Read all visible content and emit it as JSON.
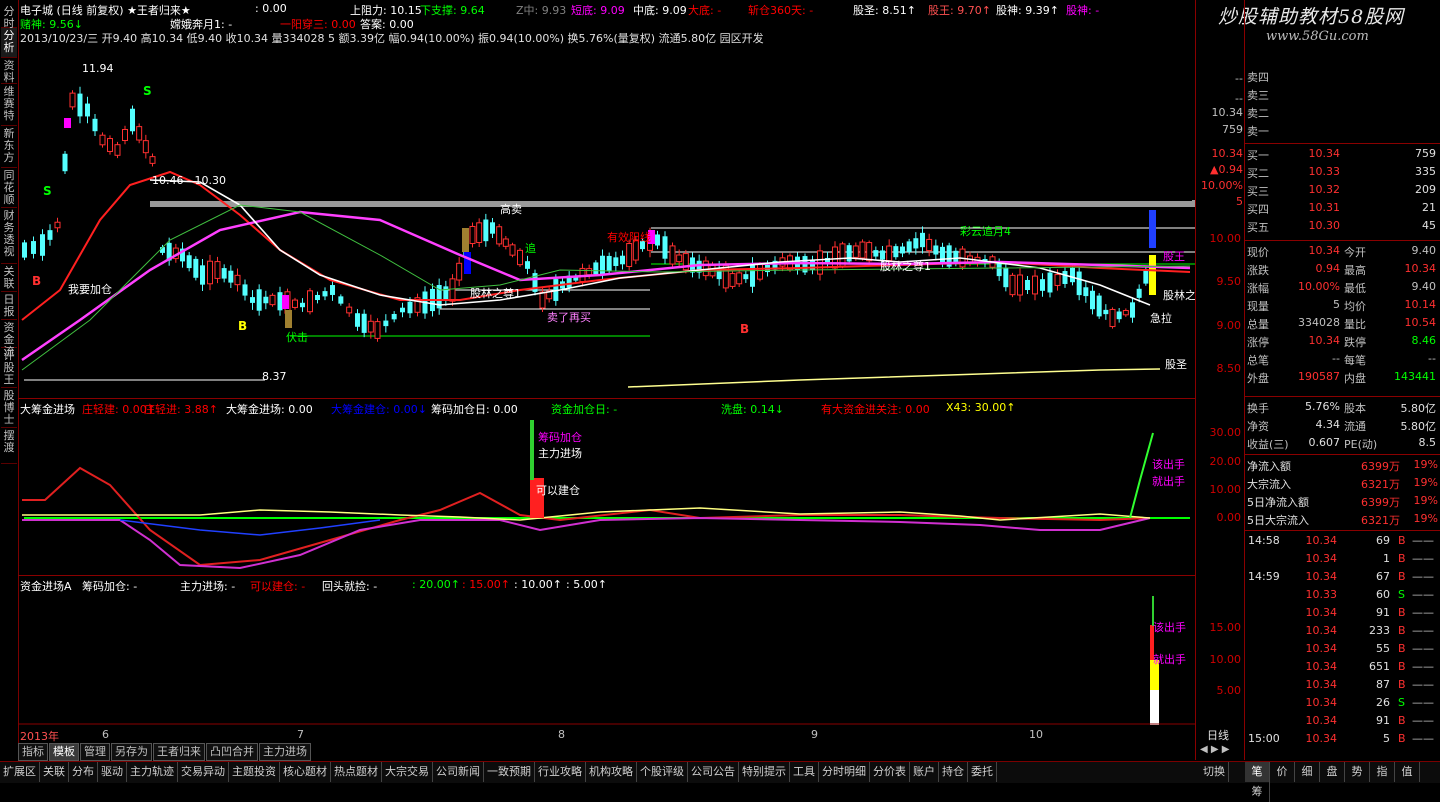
{
  "left_sidebar": [
    "分时",
    "分析",
    "资料",
    "维赛特",
    "新东方",
    "同花顺",
    "财务透视",
    "关联",
    "日报",
    "资金流",
    "评股王",
    "股博士",
    "摆渡"
  ],
  "header": {
    "row1": [
      {
        "t": "电子城 (日线 前复权) ★王者归来★",
        "c": "#ffffff"
      },
      {
        "t": ": 0.00",
        "c": "#ffffff"
      },
      {
        "t": "上阻力: 10.15",
        "c": "#ffffff"
      },
      {
        "t": "下支撑: 9.64",
        "c": "#00ff00"
      },
      {
        "t": "Z中: 9.93",
        "c": "#808080"
      },
      {
        "t": "短底: 9.09",
        "c": "#ff00ff"
      },
      {
        "t": "中底: 9.09",
        "c": "#ffffff"
      },
      {
        "t": "大底: -",
        "c": "#ff0000"
      },
      {
        "t": "斩仓360天: -",
        "c": "#ff0000"
      },
      {
        "t": "股圣: 8.51↑",
        "c": "#ffffff"
      },
      {
        "t": "股王: 9.70↑",
        "c": "#ff5050"
      },
      {
        "t": "股神: 9.39↑",
        "c": "#ffffff"
      },
      {
        "t": "股神: -",
        "c": "#ff00ff"
      }
    ],
    "row2": [
      {
        "t": "赌神: 9.56↓",
        "c": "#00ff00"
      },
      {
        "t": "嫦娥奔月1: -",
        "c": "#ffffff"
      },
      {
        "t": "一阳穿三: 0.00",
        "c": "#ff0000"
      },
      {
        "t": "答案: 0.00",
        "c": "#ffffff"
      }
    ],
    "row3": "2013/10/23/三 开9.40 高10.34 低9.40 收10.34 量334028 5 额3.39亿 幅0.94(10.00%) 振0.94(10.00%) 换5.76%(量复权) 流通5.80亿 园区开发",
    "watermark": "炒股辅助教材58股网",
    "watermark_url": "www.58Gu.com"
  },
  "main_chart": {
    "price_axis": [
      "10.00",
      "9.50",
      "9.00",
      "8.50"
    ],
    "annotations": [
      {
        "t": "11.94",
        "c": "#ffffff"
      },
      {
        "t": "10.46 - 10.30",
        "c": "#ffffff"
      },
      {
        "t": "高卖",
        "c": "#ffffff"
      },
      {
        "t": "追",
        "c": "#00ff00"
      },
      {
        "t": "我要加仓",
        "c": "#ffffff"
      },
      {
        "t": "伏击",
        "c": "#00ff00"
      },
      {
        "t": "8.37",
        "c": "#ffffff"
      },
      {
        "t": "股林之尊1",
        "c": "#ffffff"
      },
      {
        "t": "卖了再买",
        "c": "#ff80ff"
      },
      {
        "t": "有效阳线",
        "c": "#ff0000"
      },
      {
        "t": "股林之尊1",
        "c": "#ffffff"
      },
      {
        "t": "彩云追月4",
        "c": "#00ff00"
      },
      {
        "t": "股王",
        "c": "#ff00ff"
      },
      {
        "t": "股林之",
        "c": "#ffffff"
      },
      {
        "t": "急拉",
        "c": "#ffffff"
      },
      {
        "t": "股圣",
        "c": "#ffffff"
      }
    ],
    "signals": [
      "S",
      "S",
      "S",
      "B",
      "B",
      "B"
    ]
  },
  "indicator1": {
    "header": [
      {
        "t": "大筹金进场",
        "c": "#ffffff"
      },
      {
        "t": "庄轻建: 0.00↑",
        "c": "#ff0000"
      },
      {
        "t": "庄轻进: 3.88↑",
        "c": "#ff0000"
      },
      {
        "t": "大筹金进场: 0.00",
        "c": "#ffffff"
      },
      {
        "t": "大筹金建仓: 0.00↓",
        "c": "#0000ff"
      },
      {
        "t": "筹码加仓日: 0.00",
        "c": "#ffffff"
      },
      {
        "t": "资金加仓日: -",
        "c": "#00ff00"
      },
      {
        "t": "洗盘: 0.14↓",
        "c": "#00ff00"
      },
      {
        "t": "有大资金进关注: 0.00",
        "c": "#ff0000"
      },
      {
        "t": "X43: 30.00↑",
        "c": "#ffff00"
      }
    ],
    "axis": [
      "30.00",
      "20.00",
      "10.00",
      "0.00"
    ],
    "labels": [
      {
        "t": "筹码加仓",
        "c": "#ff00ff"
      },
      {
        "t": "主力进场",
        "c": "#ffffff"
      },
      {
        "t": "可以建仓",
        "c": "#ffffff"
      },
      {
        "t": "该出手",
        "c": "#ff00ff"
      },
      {
        "t": "就出手",
        "c": "#ff00ff"
      }
    ]
  },
  "indicator2": {
    "header": [
      {
        "t": "资金进场A",
        "c": "#ffffff"
      },
      {
        "t": "筹码加仓: -",
        "c": "#ffffff"
      },
      {
        "t": "主力进场: -",
        "c": "#ffffff"
      },
      {
        "t": "可以建仓: -",
        "c": "#ff0000"
      },
      {
        "t": "回头就捡: -",
        "c": "#ffffff"
      },
      {
        "t": ": 20.00↑",
        "c": "#00ff00"
      },
      {
        "t": ": 15.00↑",
        "c": "#ff0000"
      },
      {
        "t": ": 10.00↑",
        "c": "#ffffff"
      },
      {
        "t": ": 5.00↑",
        "c": "#ffffff"
      }
    ],
    "axis": [
      "15.00",
      "10.00",
      "5.00"
    ],
    "labels": [
      {
        "t": "该出手",
        "c": "#ff00ff"
      },
      {
        "t": "就出手",
        "c": "#ff00ff"
      }
    ]
  },
  "time_axis": [
    "2013年",
    "6",
    "7",
    "8",
    "9",
    "10"
  ],
  "chart_tabs": [
    "指标",
    "模板",
    "管理",
    "另存为",
    "王者归来",
    "凸凹合并",
    "主力进场"
  ],
  "rightpanel": {
    "mid": [
      "--",
      "--",
      "10.34",
      "759",
      "10.34",
      "▲0.94",
      "10.00%",
      "5"
    ],
    "sell": [
      {
        "l": "卖四",
        "p": "",
        "v": ""
      },
      {
        "l": "卖三",
        "p": "",
        "v": ""
      },
      {
        "l": "卖二",
        "p": "",
        "v": ""
      },
      {
        "l": "卖一",
        "p": "",
        "v": ""
      }
    ],
    "buy": [
      {
        "l": "买一",
        "p": "10.34",
        "v": "759"
      },
      {
        "l": "买二",
        "p": "10.33",
        "v": "335"
      },
      {
        "l": "买三",
        "p": "10.32",
        "v": "209"
      },
      {
        "l": "买四",
        "p": "10.31",
        "v": "21"
      },
      {
        "l": "买五",
        "p": "10.30",
        "v": "45"
      }
    ],
    "quote": [
      {
        "a": "现价",
        "av": "10.34",
        "ac": "#ff3030",
        "b": "今开",
        "bv": "9.40",
        "bc": "#c0c0c0"
      },
      {
        "a": "涨跌",
        "av": "0.94",
        "ac": "#ff3030",
        "b": "最高",
        "bv": "10.34",
        "bc": "#ff3030"
      },
      {
        "a": "涨幅",
        "av": "10.00%",
        "ac": "#ff3030",
        "b": "最低",
        "bv": "9.40",
        "bc": "#c0c0c0"
      },
      {
        "a": "现量",
        "av": "5",
        "ac": "#c0c0c0",
        "b": "均价",
        "bv": "10.14",
        "bc": "#ff3030"
      },
      {
        "a": "总量",
        "av": "334028",
        "ac": "#c0c0c0",
        "b": "量比",
        "bv": "10.54",
        "bc": "#ff3030"
      },
      {
        "a": "涨停",
        "av": "10.34",
        "ac": "#ff3030",
        "b": "跌停",
        "bv": "8.46",
        "bc": "#00ff00"
      },
      {
        "a": "总笔",
        "av": "--",
        "ac": "#c0c0c0",
        "b": "每笔",
        "bv": "--",
        "bc": "#c0c0c0"
      },
      {
        "a": "外盘",
        "av": "190587",
        "ac": "#ff3030",
        "b": "内盘",
        "bv": "143441",
        "bc": "#00ff00"
      }
    ],
    "quote2": [
      {
        "a": "换手",
        "av": "5.76%",
        "b": "股本",
        "bv": "5.80亿"
      },
      {
        "a": "净资",
        "av": "4.34",
        "b": "流通",
        "bv": "5.80亿"
      },
      {
        "a": "收益(三)",
        "av": "0.607",
        "b": "PE(动)",
        "bv": "8.5"
      }
    ],
    "flows": [
      {
        "a": "净流入额",
        "v": "6399万",
        "p": "19%"
      },
      {
        "a": "大宗流入",
        "v": "6321万",
        "p": "19%"
      },
      {
        "a": "5日净流入额",
        "v": "6399万",
        "p": "19%"
      },
      {
        "a": "5日大宗流入",
        "v": "6321万",
        "p": "19%"
      }
    ],
    "ticks": [
      {
        "t": "14:58",
        "p": "10.34",
        "v": "69",
        "d": "B",
        "dc": "#ff3030"
      },
      {
        "t": "",
        "p": "10.34",
        "v": "1",
        "d": "B",
        "dc": "#ff3030"
      },
      {
        "t": "14:59",
        "p": "10.34",
        "v": "67",
        "d": "B",
        "dc": "#ff3030"
      },
      {
        "t": "",
        "p": "10.33",
        "v": "60",
        "d": "S",
        "dc": "#00ff00"
      },
      {
        "t": "",
        "p": "10.34",
        "v": "91",
        "d": "B",
        "dc": "#ff3030"
      },
      {
        "t": "",
        "p": "10.34",
        "v": "233",
        "d": "B",
        "dc": "#ff3030"
      },
      {
        "t": "",
        "p": "10.34",
        "v": "55",
        "d": "B",
        "dc": "#ff3030"
      },
      {
        "t": "",
        "p": "10.34",
        "v": "651",
        "d": "B",
        "dc": "#ff3030"
      },
      {
        "t": "",
        "p": "10.34",
        "v": "87",
        "d": "B",
        "dc": "#ff3030"
      },
      {
        "t": "",
        "p": "10.34",
        "v": "26",
        "d": "S",
        "dc": "#00ff00"
      },
      {
        "t": "",
        "p": "10.34",
        "v": "91",
        "d": "B",
        "dc": "#ff3030"
      },
      {
        "t": "15:00",
        "p": "10.34",
        "v": "5",
        "d": "B",
        "dc": "#ff3030"
      }
    ],
    "period": "日线",
    "rtabs": [
      "笔",
      "价",
      "细",
      "盘",
      "势",
      "指",
      "值",
      "筹"
    ]
  },
  "bottom_menu": [
    "扩展区",
    "关联",
    "分布",
    "驱动",
    "主力轨迹",
    "交易异动",
    "主题投资",
    "核心题材",
    "热点题材",
    "大宗交易",
    "公司新闻",
    "一致预期",
    "行业攻略",
    "机构攻略",
    "个股评级",
    "公司公告",
    "特别提示",
    "工具",
    "分时明细",
    "分价表",
    "账户",
    "持仓",
    "委托"
  ],
  "bottom_right": [
    "切",
    "换"
  ]
}
